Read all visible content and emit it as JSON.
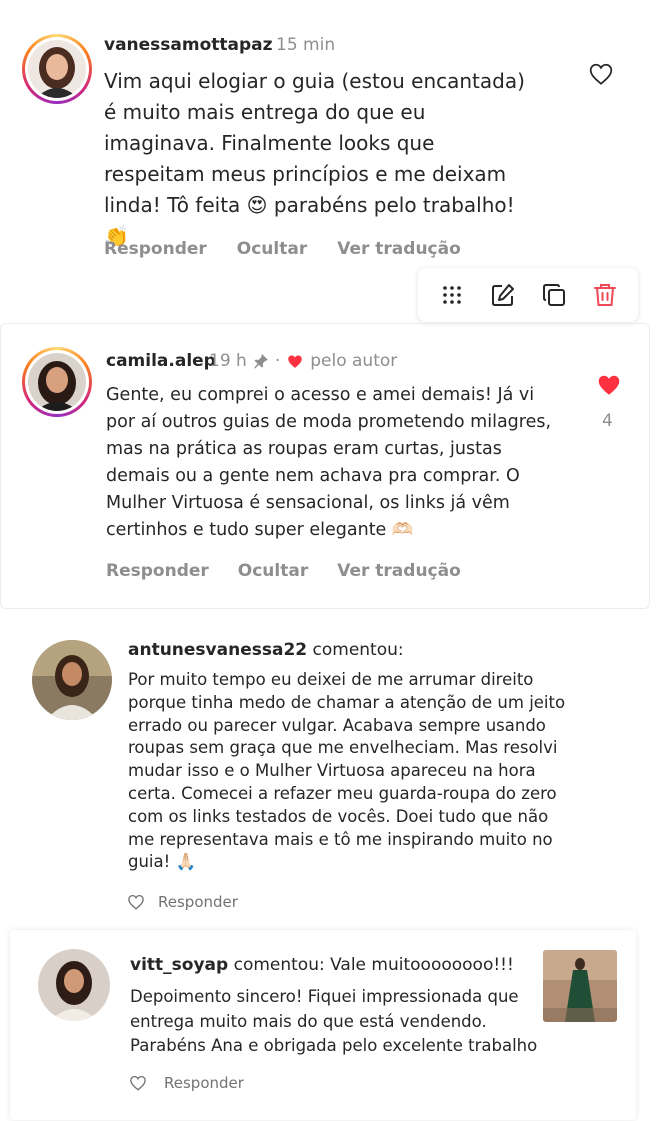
{
  "comments": [
    {
      "username": "vanessamottapaz",
      "time": "15 min",
      "text": "Vim aqui elogiar o guia (estou encantada) é muito mais entrega do que eu imaginava. Finalmente looks que respeitam meus princípios e me deixam linda! Tô feita 😍 parabéns pelo trabalho! 👏",
      "actions": [
        "Responder",
        "Ocultar",
        "Ver tradução"
      ],
      "liked": false
    },
    {
      "username": "camila.alep",
      "time": "19 h",
      "author_label": "pelo autor",
      "text": "Gente, eu comprei o acesso e amei demais! Já vi por aí outros guias de moda prometendo milagres, mas na prática as roupas eram curtas, justas demais ou a gente nem achava pra comprar. O Mulher Virtuosa é sensacional, os links já vêm certinhos e tudo super elegante 🫶🏻",
      "actions": [
        "Responder",
        "Ocultar",
        "Ver tradução"
      ],
      "liked": true,
      "like_count": "4"
    },
    {
      "username": "antunesvanessa22",
      "verb": "comentou:",
      "text": "Por muito tempo eu deixei de me arrumar direito porque tinha medo de chamar a atenção de um jeito errado ou parecer vulgar. Acabava sempre usando roupas sem graça que me envelheciam. Mas resolvi mudar isso e o Mulher Virtuosa apareceu na hora certa. Comecei a refazer meu guarda-roupa do zero com os links testados de vocês. Doei tudo que não me representava mais e tô me inspirando muito no guia! 🙏🏻",
      "reply_label": "Responder"
    },
    {
      "username": "vitt_soyap",
      "verb": "comentou: Vale muitoooooooo!!!",
      "text": "Depoimento sincero! Fiquei impressionada que entrega muito mais do que está vendendo. Parabéns Ana e obrigada pelo excelente trabalho",
      "reply_label": "Responder"
    }
  ],
  "toolbar_icons": [
    "drag-handle-icon",
    "edit-icon",
    "copy-icon",
    "delete-icon"
  ],
  "colors": {
    "text": "#262626",
    "muted": "#8e8e8e",
    "like_red": "#ff3040",
    "delete_red": "#ed4956"
  }
}
